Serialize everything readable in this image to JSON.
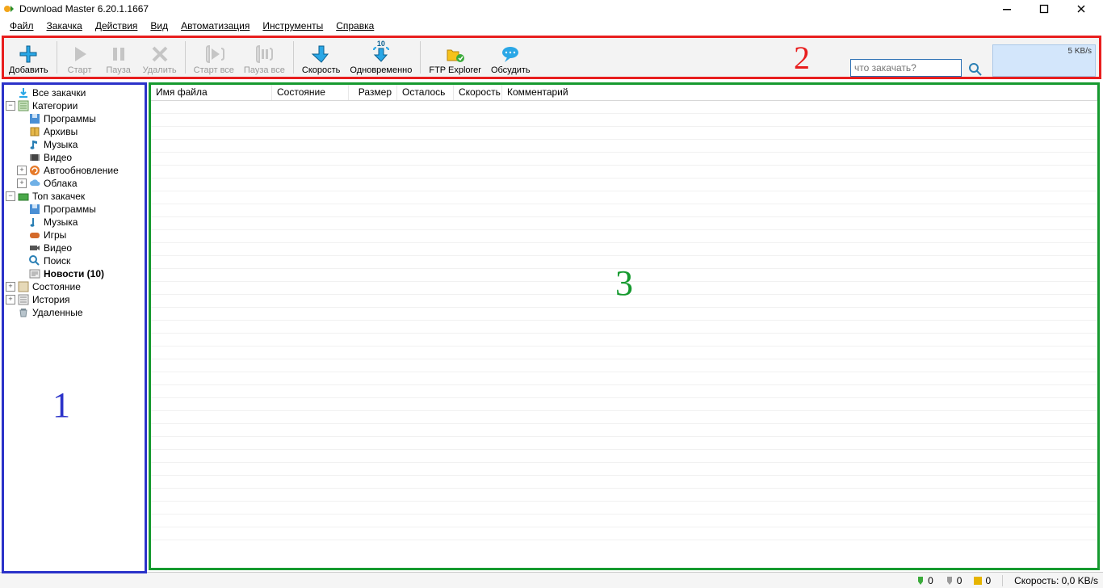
{
  "window": {
    "title": "Download Master 6.20.1.1667"
  },
  "menu": [
    "Файл",
    "Закачка",
    "Действия",
    "Вид",
    "Автоматизация",
    "Инструменты",
    "Справка"
  ],
  "toolbar": {
    "add": "Добавить",
    "start": "Старт",
    "pause": "Пауза",
    "delete": "Удалить",
    "start_all": "Старт все",
    "pause_all": "Пауза все",
    "speed": "Скорость",
    "concurrent": "Одновременно",
    "concurrent_count": "10",
    "ftp": "FTP Explorer",
    "discuss": "Обсудить"
  },
  "search": {
    "placeholder": "что закачать?"
  },
  "speed_indicator": "5 KB/s",
  "annotations": {
    "sidebar": "1",
    "toolbar": "2",
    "grid": "3"
  },
  "tree": {
    "all_downloads": "Все закачки",
    "categories": "Категории",
    "cat_programs": "Программы",
    "cat_archives": "Архивы",
    "cat_music": "Музыка",
    "cat_video": "Видео",
    "cat_autoupdate": "Автообновление",
    "cat_clouds": "Облака",
    "top_downloads": "Топ закачек",
    "top_programs": "Программы",
    "top_music": "Музыка",
    "top_games": "Игры",
    "top_video": "Видео",
    "top_search": "Поиск",
    "top_news": "Новости (10)",
    "status": "Состояние",
    "history": "История",
    "deleted": "Удаленные"
  },
  "columns": {
    "filename": "Имя файла",
    "status": "Состояние",
    "size": "Размер",
    "remaining": "Осталось",
    "speed": "Скорость",
    "comment": "Комментарий"
  },
  "statusbar": {
    "green": "0",
    "gray": "0",
    "yellow": "0",
    "speed_label": "Скорость: 0,0 KB/s"
  }
}
